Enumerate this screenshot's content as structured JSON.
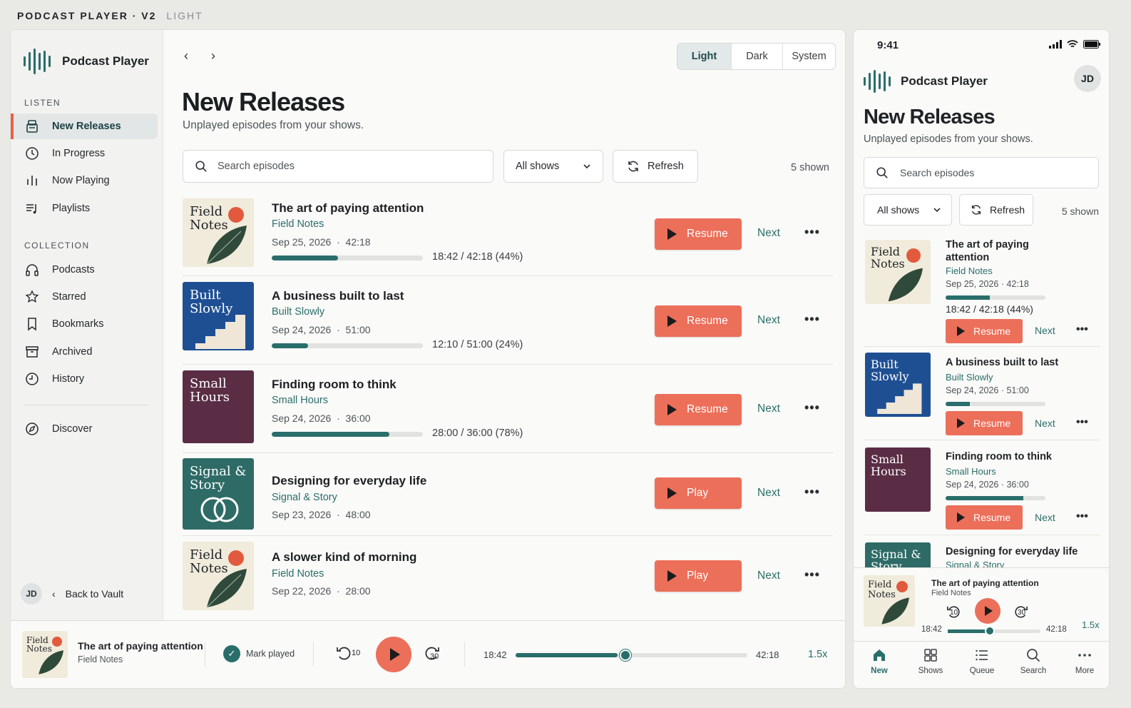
{
  "caption": {
    "title": "PODCAST PLAYER · V2",
    "mode": "LIGHT"
  },
  "app": {
    "name": "Podcast Player"
  },
  "sidebar": {
    "listen_label": "LISTEN",
    "listen_items": [
      {
        "label": "New Releases",
        "icon": "podcast-stack-icon",
        "active": true
      },
      {
        "label": "In Progress",
        "icon": "clock-icon"
      },
      {
        "label": "Now Playing",
        "icon": "waveform-icon"
      },
      {
        "label": "Playlists",
        "icon": "playlist-icon"
      }
    ],
    "collection_label": "COLLECTION",
    "collection_items": [
      {
        "label": "Podcasts",
        "icon": "headphones-icon"
      },
      {
        "label": "Starred",
        "icon": "star-icon"
      },
      {
        "label": "Bookmarks",
        "icon": "bookmark-icon"
      },
      {
        "label": "Archived",
        "icon": "archive-icon"
      },
      {
        "label": "History",
        "icon": "history-icon"
      }
    ],
    "discover": {
      "label": "Discover",
      "icon": "compass-icon"
    },
    "user_initials": "JD",
    "back_label": "Back to Vault"
  },
  "theme_toggle": [
    "Light",
    "Dark",
    "System"
  ],
  "page": {
    "title": "New Releases",
    "subtitle": "Unplayed episodes from your shows.",
    "search_placeholder": "Search episodes",
    "filter_value": "All shows",
    "refresh_label": "Refresh",
    "count_label": "5 shown"
  },
  "episodes": [
    {
      "title": "The art of paying attention",
      "show": "Field Notes",
      "date": "Sep 25, 2026",
      "duration": "42:18",
      "progress": 0.44,
      "progress_text": "18:42 / 42:18 (44%)",
      "action": "Resume",
      "cover": "field",
      "cover_title": "Field Notes"
    },
    {
      "title": "A business built to last",
      "show": "Built Slowly",
      "date": "Sep 24, 2026",
      "duration": "51:00",
      "progress": 0.24,
      "progress_text": "12:10 / 51:00 (24%)",
      "action": "Resume",
      "cover": "built",
      "cover_title": "Built Slowly"
    },
    {
      "title": "Finding room to think",
      "show": "Small Hours",
      "date": "Sep 24, 2026",
      "duration": "36:00",
      "progress": 0.78,
      "progress_text": "28:00 / 36:00 (78%)",
      "action": "Resume",
      "cover": "small",
      "cover_title": "Small Hours"
    },
    {
      "title": "Designing for everyday life",
      "show": "Signal & Story",
      "date": "Sep 23, 2026",
      "duration": "48:00",
      "progress": 0,
      "progress_text": "",
      "action": "Play",
      "cover": "signal",
      "cover_title": "Signal & Story"
    },
    {
      "title": "A slower kind of morning",
      "show": "Field Notes",
      "date": "Sep 22, 2026",
      "duration": "28:00",
      "progress": 0,
      "progress_text": "",
      "action": "Play",
      "cover": "field",
      "cover_title": "Field Notes"
    }
  ],
  "row_actions": {
    "next": "Next",
    "more": "•••"
  },
  "player": {
    "title": "The art of paying attention",
    "show": "Field Notes",
    "cover_title": "Field Notes",
    "mark_played": "Mark played",
    "skip_back": "10",
    "skip_fwd": "30",
    "elapsed": "18:42",
    "total": "42:18",
    "progress": 0.44,
    "speed": "1.5x"
  },
  "mobile": {
    "status_time": "9:41",
    "avatar": "JD",
    "progress_text_first": "18:42 / 42:18 (44%)",
    "tabs": [
      {
        "label": "New",
        "icon": "home-icon",
        "active": true
      },
      {
        "label": "Shows",
        "icon": "grid-icon"
      },
      {
        "label": "Queue",
        "icon": "queue-icon"
      },
      {
        "label": "Search",
        "icon": "search-icon"
      },
      {
        "label": "More",
        "icon": "more-icon"
      }
    ]
  },
  "colors": {
    "accent": "#ec6f5a",
    "brand": "#2a6e6b",
    "field_bg": "#f1ebdc",
    "built_bg": "#1f4f93",
    "small_bg": "#5a2d45",
    "signal_bg": "#2e6b66"
  }
}
